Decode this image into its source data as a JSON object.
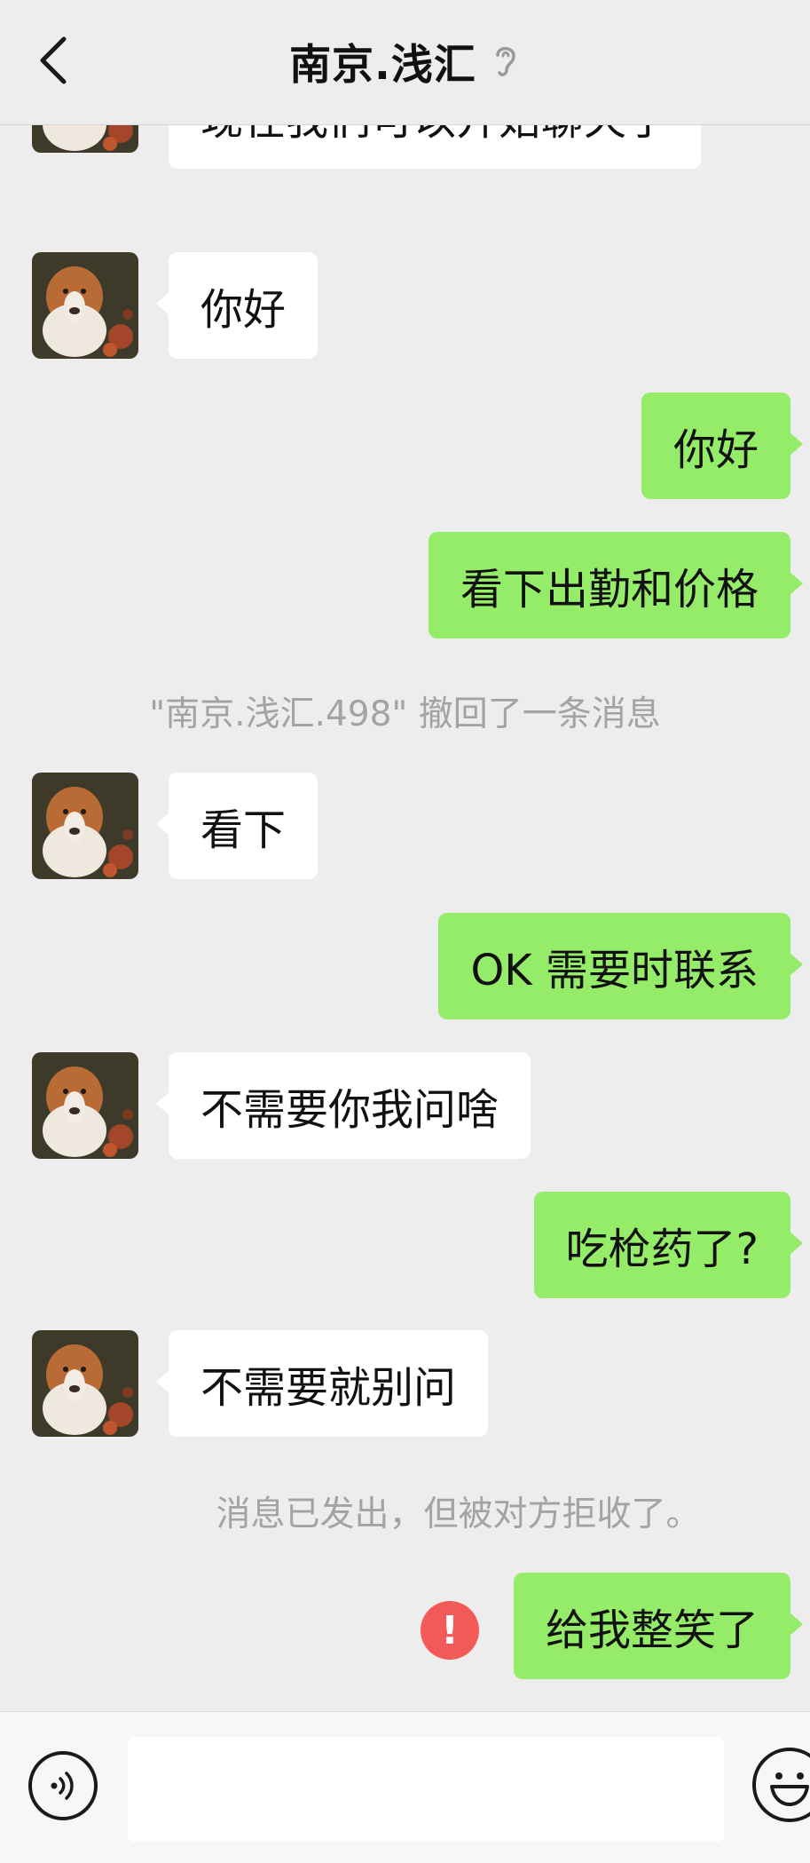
{
  "header": {
    "title": "南京.浅汇",
    "back_icon": "chevron-left-icon",
    "ear_icon": "earpiece-mode-icon"
  },
  "messages": [
    {
      "side": "in",
      "text": "现在我们可以开始聊天了"
    },
    {
      "side": "in",
      "text": "你好"
    },
    {
      "side": "out",
      "text": "你好"
    },
    {
      "side": "out",
      "text": "看下出勤和价格"
    },
    {
      "side": "system",
      "text": "\"南京.浅汇.498\" 撤回了一条消息"
    },
    {
      "side": "in",
      "text": "看下"
    },
    {
      "side": "out",
      "text": "OK 需要时联系"
    },
    {
      "side": "in",
      "text": "不需要你我问啥"
    },
    {
      "side": "out",
      "text": "吃枪药了?"
    },
    {
      "side": "in",
      "text": "不需要就别问"
    },
    {
      "side": "system",
      "text": "消息已发出，但被对方拒收了。"
    },
    {
      "side": "out",
      "text": "给我整笑了",
      "failed": true
    }
  ],
  "colors": {
    "background": "#ededed",
    "outgoing_bubble": "#95ec69",
    "incoming_bubble": "#ffffff",
    "error": "#f25a58"
  },
  "bottom_bar": {
    "voice_icon": "voice-input-icon",
    "emoji_icon": "emoji-icon",
    "input_value": ""
  }
}
